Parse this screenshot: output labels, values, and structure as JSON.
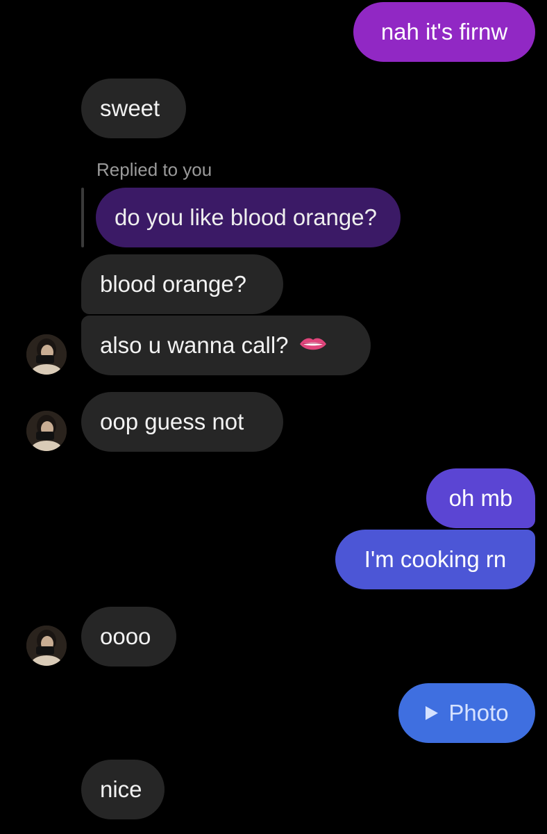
{
  "messages": [
    {
      "id": "m1",
      "sender": "me",
      "text": "nah it's firnw"
    },
    {
      "id": "m2",
      "sender": "them",
      "text": "sweet"
    },
    {
      "id": "m3",
      "sender": "them",
      "reply_label": "Replied to you",
      "quoted_text": "do you like blood orange?"
    },
    {
      "id": "m4",
      "sender": "them",
      "text": "blood orange?"
    },
    {
      "id": "m5",
      "sender": "them",
      "text": "also u wanna call?",
      "emoji": "lips-biting-emoji"
    },
    {
      "id": "m6",
      "sender": "them",
      "text": "oop guess not"
    },
    {
      "id": "m7",
      "sender": "me",
      "text": "oh mb"
    },
    {
      "id": "m8",
      "sender": "me",
      "text": "I'm cooking rn"
    },
    {
      "id": "m9",
      "sender": "them",
      "text": "oooo"
    },
    {
      "id": "m10",
      "sender": "me",
      "attachment_label": "Photo",
      "icon": "play-icon"
    },
    {
      "id": "m11",
      "sender": "them",
      "text": "nice"
    }
  ],
  "colors": {
    "incoming_bubble": "#262626",
    "outgoing_purple": "#8a2fc7",
    "outgoing_violet": "#5b4ad6",
    "outgoing_blue": "#4a5fd8",
    "outgoing_photo": "#3f6fe0",
    "quoted_bubble": "#3b1a66",
    "background": "#000000"
  }
}
